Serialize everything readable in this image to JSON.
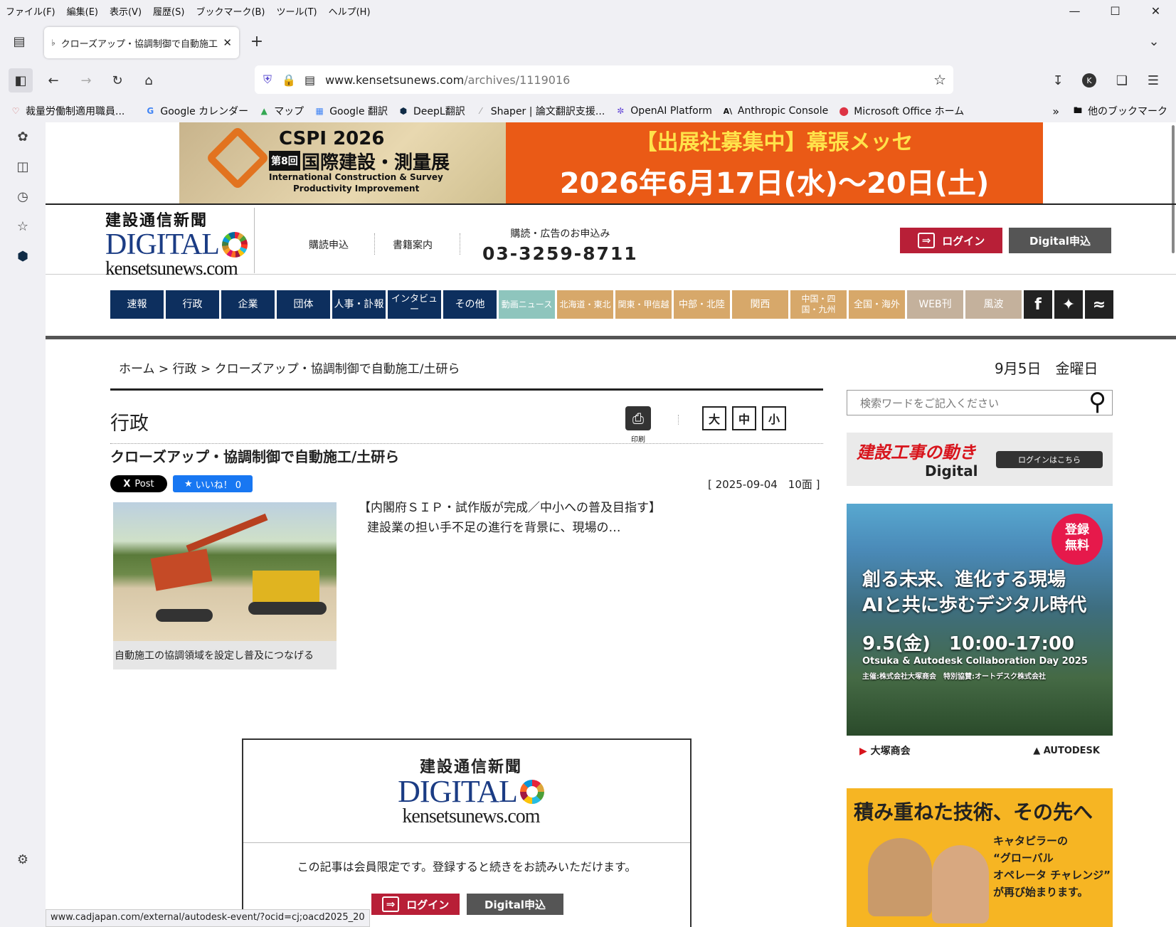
{
  "menubar": {
    "items": [
      "ファイル(F)",
      "編集(E)",
      "表示(V)",
      "履歴(S)",
      "ブックマーク(B)",
      "ツール(T)",
      "ヘルプ(H)"
    ]
  },
  "tab": {
    "title": "クローズアップ・協調制御で自動施工"
  },
  "url": {
    "host": "www.kensetsunews.com",
    "path": "/archives/1119016"
  },
  "bookmarks": [
    {
      "label": "裁量労働制適用職員...",
      "icon": "heart-icon"
    },
    {
      "label": "Google カレンダー",
      "icon": "google-icon"
    },
    {
      "label": "マップ",
      "icon": "map-icon"
    },
    {
      "label": "Google 翻訳",
      "icon": "translate-icon"
    },
    {
      "label": "DeepL翻訳",
      "icon": "deepl-icon"
    },
    {
      "label": "Shaper | 論文翻訳支援...",
      "icon": "shaper-icon"
    },
    {
      "label": "OpenAI Platform",
      "icon": "openai-icon"
    },
    {
      "label": "Anthropic Console",
      "icon": "anthropic-icon"
    },
    {
      "label": "Microsoft Office ホーム",
      "icon": "office-icon"
    }
  ],
  "bookmarks_other": "他のブックマーク",
  "banner": {
    "title": "CSPI 2026",
    "edition": "第8回",
    "name": "国際建設・測量展",
    "sub1": "International Construction & Survey",
    "sub2": "Productivity Improvement",
    "r1": "【出展社募集中】幕張メッセ",
    "r2": "2026年6月17日(水)～20日(土)"
  },
  "logo": {
    "jp": "建設通信新聞",
    "digital": "DIGITAL",
    "domain": "kensetsunews.com"
  },
  "header": {
    "subscribe": "購読申込",
    "books": "書籍案内",
    "tel_label": "購読・広告のお申込み",
    "tel": "03-3259-8711",
    "login": "ログイン",
    "digital": "Digital申込"
  },
  "gnav": [
    {
      "label": "速報",
      "color": "#0d2f5e"
    },
    {
      "label": "行政",
      "color": "#0d2f5e"
    },
    {
      "label": "企業",
      "color": "#0d2f5e"
    },
    {
      "label": "団体",
      "color": "#0d2f5e"
    },
    {
      "label": "人事・訃報",
      "color": "#0d2f5e"
    },
    {
      "label": "インタビュー",
      "color": "#0d2f5e"
    },
    {
      "label": "その他",
      "color": "#0d2f5e"
    },
    {
      "label": "動画ニュース",
      "color": "#8ec5bd"
    },
    {
      "label": "北海道・東北",
      "color": "#d7a86a"
    },
    {
      "label": "関東・甲信越",
      "color": "#d7a86a"
    },
    {
      "label": "中部・北陸",
      "color": "#d7a86a"
    },
    {
      "label": "関西",
      "color": "#d7a86a"
    },
    {
      "label": "中国・四国・九州",
      "color": "#d7a86a"
    },
    {
      "label": "全国・海外",
      "color": "#d7a86a"
    },
    {
      "label": "WEB刊",
      "color": "#c4b19c"
    },
    {
      "label": "風波",
      "color": "#c4b19c"
    }
  ],
  "breadcrumb": {
    "home": "ホーム",
    "cat": "行政",
    "title": "クローズアップ・協調制御で自動施工/土研ら",
    "sep": ">"
  },
  "date": "9月5日　金曜日",
  "section": {
    "title": "行政",
    "print": "印刷",
    "font_large": "大",
    "font_mid": "中",
    "font_small": "小"
  },
  "article": {
    "headline": "クローズアップ・協調制御で自動施工/土研ら",
    "x_post": "Post",
    "fb_like": "いいね！ 0",
    "pubdate": "[ 2025-09-04　10面 ]",
    "caption": "自動施工の協調領域を設定し普及につなげる",
    "lead1": "【内閣府ＳＩＰ・試作版が完成／中小への普及目指す】",
    "lead2": "建設業の担い手不足の進行を背景に、現場の…"
  },
  "members": {
    "msg": "この記事は会員限定です。登録すると続きをお読みいただけます。",
    "login": "ログイン",
    "digital": "Digital申込"
  },
  "search": {
    "placeholder": "検索ワードをご記入ください"
  },
  "ad1": {
    "title": "建設工事の動き",
    "sub": "Digital",
    "btn": "ログインはこちら"
  },
  "ad2": {
    "badge1": "登録",
    "badge2": "無料",
    "l1": "創る未来、進化する現場",
    "l2": "AIと共に歩むデジタル時代",
    "l3": "9.5(金)　10:00-17:00",
    "l4": "Otsuka & Autodesk Collaboration Day 2025",
    "l5": "主催:株式会社大塚商会　特別協賛:オートデスク株式会社",
    "f1": "大塚商会",
    "f2": "AUTODESK"
  },
  "ad3": {
    "title": "積み重ねた技術、その先へ",
    "t1": "キャタピラーの",
    "t2": "“グローバル",
    "t3": "オペレータ チャレンジ”",
    "t4": "が再び始まります。"
  },
  "status": "www.cadjapan.com/external/autodesk-event/?ocid=cj;oacd2025_20"
}
